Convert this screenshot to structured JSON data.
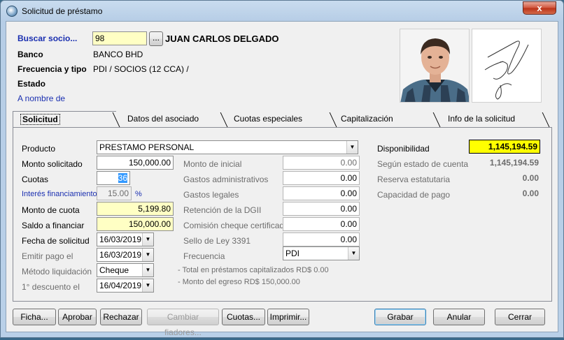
{
  "window": {
    "title": "Solicitud de préstamo",
    "close_glyph": "x"
  },
  "header": {
    "buscar_label": "Buscar socio...",
    "socio_id": "98",
    "browse_button": "...",
    "socio_name": "JUAN CARLOS DELGADO",
    "banco_label": "Banco",
    "banco_value": "BANCO BHD",
    "frecuencia_label": "Frecuencia y tipo",
    "frecuencia_value": "PDI / SOCIOS (12 CCA) /",
    "estado_label": "Estado",
    "a_nombre_label": "A nombre de"
  },
  "tabs": [
    {
      "label": "Solicitud",
      "active": true
    },
    {
      "label": "Datos del asociado"
    },
    {
      "label": "Cuotas especiales"
    },
    {
      "label": "Capitalización"
    },
    {
      "label": "Info de la solicitud"
    }
  ],
  "form": {
    "producto_label": "Producto",
    "producto_value": "PRESTAMO PERSONAL",
    "monto_solicitado_label": "Monto solicitado",
    "monto_solicitado_value": "150,000.00",
    "cuotas_label": "Cuotas",
    "cuotas_value": "36",
    "interes_label": "Interés financiamiento",
    "interes_value": "15.00",
    "interes_unit": "%",
    "monto_cuota_label": "Monto de cuota",
    "monto_cuota_value": "5,199.80",
    "saldo_label": "Saldo a financiar",
    "saldo_value": "150,000.00",
    "fecha_solicitud_label": "Fecha de solicitud",
    "fecha_solicitud_value": "16/03/2019",
    "emitir_label": "Emitir pago el",
    "emitir_value": "16/03/2019",
    "metodo_label": "Método liquidación",
    "metodo_value": "Cheque",
    "descuento_label": "1° descuento el",
    "descuento_value": "16/04/2019"
  },
  "charges": {
    "monto_inicial_label": "Monto de inicial",
    "monto_inicial_value": "0.00",
    "gastos_admin_label": "Gastos administrativos",
    "gastos_admin_value": "0.00",
    "gastos_legales_label": "Gastos legales",
    "gastos_legales_value": "0.00",
    "retencion_label": "Retención de la DGII",
    "retencion_value": "0.00",
    "comision_label": "Comisión cheque certificado",
    "comision_value": "0.00",
    "sello_label": "Sello de Ley 3391",
    "sello_value": "0.00",
    "frecuencia_label": "Frecuencia",
    "frecuencia_value": "PDI",
    "note_capitalizados": "- Total en préstamos capitalizados RD$ 0.00",
    "note_egreso": "- Monto del egreso RD$ 150,000.00"
  },
  "summary": {
    "disponibilidad_label": "Disponibilidad",
    "disponibilidad_value": "1,145,194.59",
    "segun_label": "Según estado de cuenta",
    "segun_value": "1,145,194.59",
    "reserva_label": "Reserva estatutaria",
    "reserva_value": "0.00",
    "capacidad_label": "Capacidad de pago",
    "capacidad_value": "0.00"
  },
  "buttons": {
    "ficha": "Ficha...",
    "aprobar": "Aprobar",
    "rechazar": "Rechazar",
    "cambiar_fiadores": "Cambiar fiadores...",
    "cuotas": "Cuotas...",
    "imprimir": "Imprimir...",
    "grabar": "Grabar",
    "anular": "Anular",
    "cerrar": "Cerrar"
  },
  "colors": {
    "highlight_yellow": "#ffff00",
    "field_yellow": "#ffffc4",
    "link_blue": "#1a2fb0"
  }
}
